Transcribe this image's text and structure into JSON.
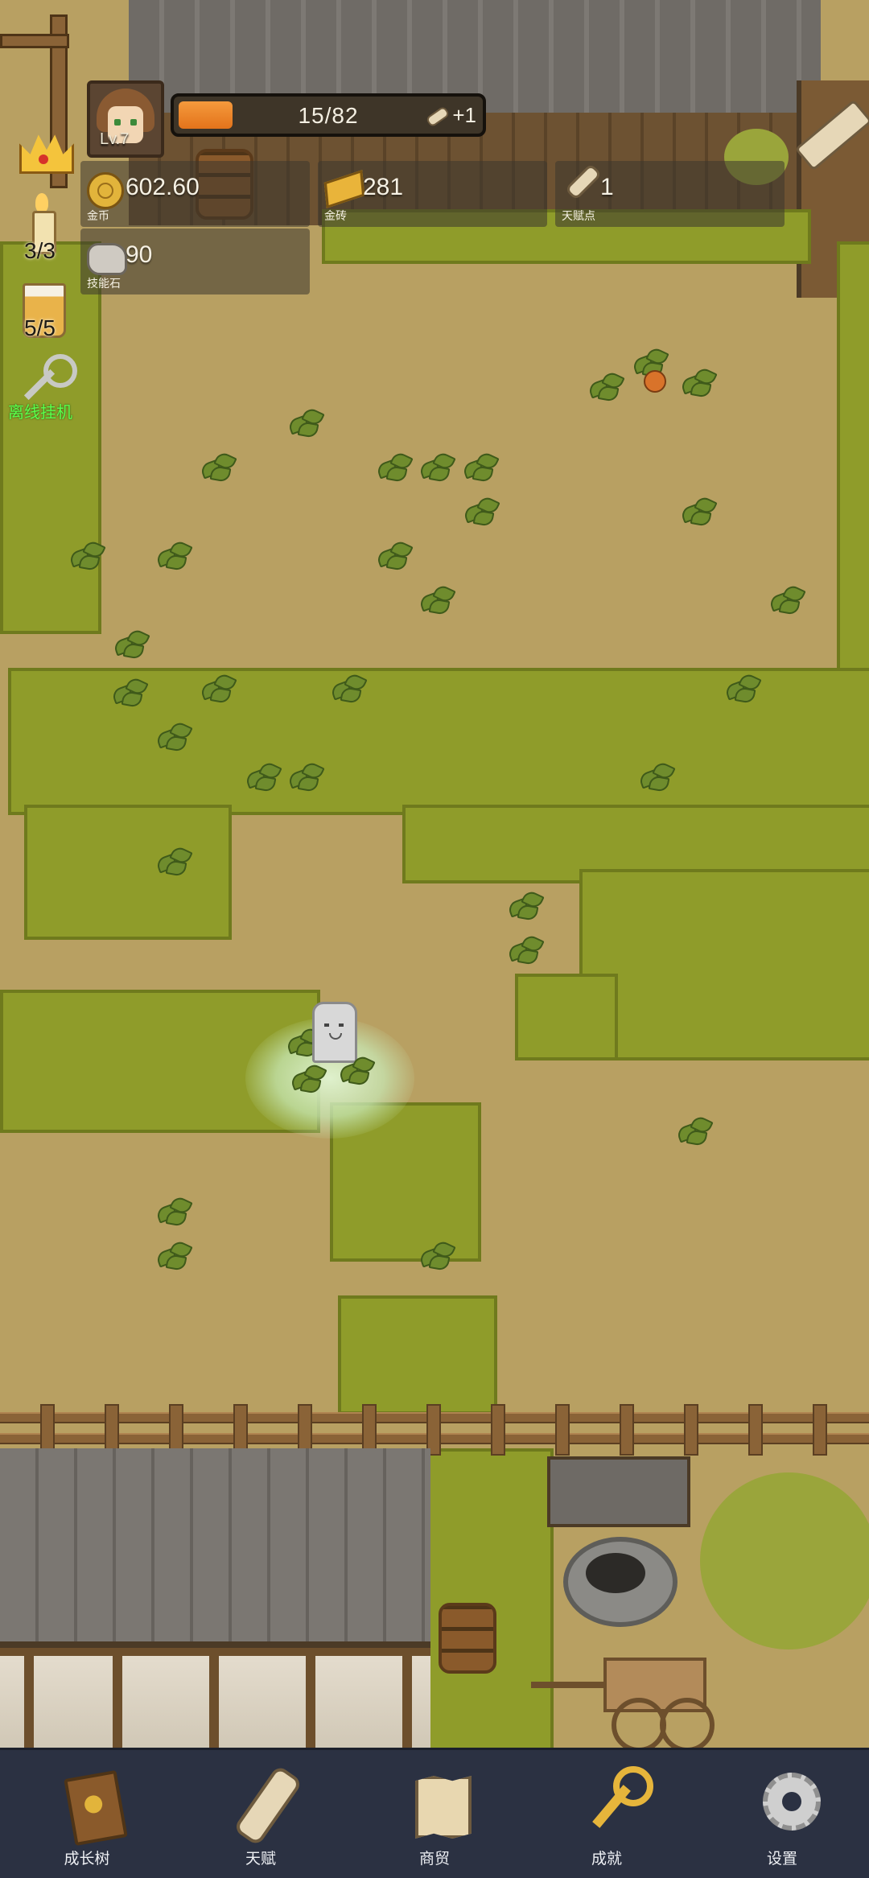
{
  "player": {
    "level": "Lv.7"
  },
  "xp": {
    "text": "15/82",
    "progress": 0.18,
    "gain": "+1"
  },
  "resources": [
    {
      "value": "602.60",
      "label": "金币",
      "icon": "coin-icon"
    },
    {
      "value": "281",
      "label": "金砖",
      "icon": "gold-bar-icon"
    },
    {
      "value": "1",
      "label": "天赋点",
      "icon": "talent-scroll-icon"
    },
    {
      "value": "90",
      "label": "技能石",
      "icon": "skill-stone-icon"
    }
  ],
  "side": {
    "candle_count": "3/3",
    "drink_count": "5/5",
    "afk_label": "离线挂机"
  },
  "nav": [
    {
      "label": "成长树",
      "icon": "book-icon"
    },
    {
      "label": "天赋",
      "icon": "scroll-icon"
    },
    {
      "label": "商贸",
      "icon": "map-icon"
    },
    {
      "label": "成就",
      "icon": "key-icon"
    },
    {
      "label": "设置",
      "icon": "gear-icon"
    }
  ],
  "colors": {
    "xp_fill": "#f08a2a",
    "afk_text": "#5cff4b",
    "nav_bg": "#2b3142"
  }
}
